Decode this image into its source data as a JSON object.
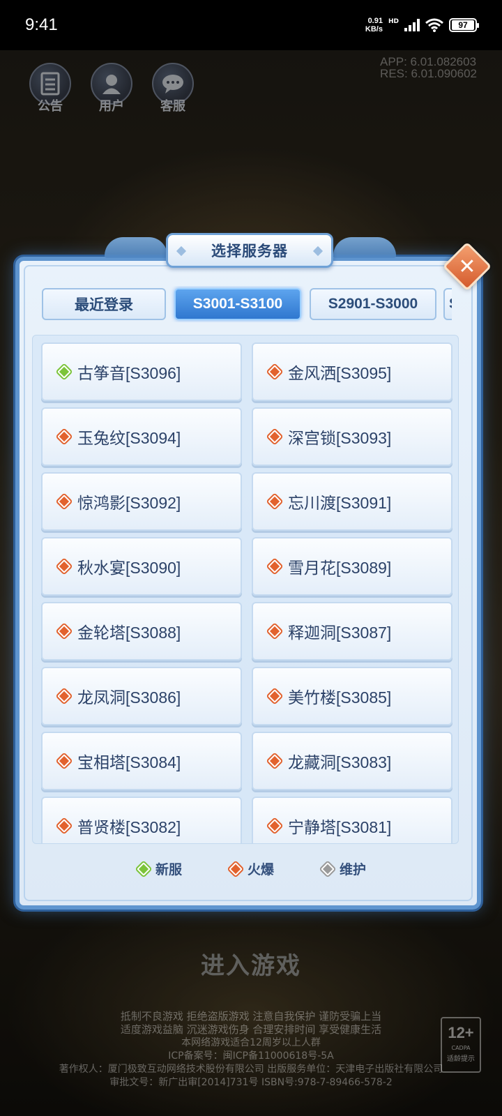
{
  "status_bar": {
    "time": "9:41",
    "speed_value": "0.91",
    "speed_unit": "KB/s",
    "net_type": "HD",
    "battery": "97"
  },
  "top_icons": [
    {
      "label": "公告",
      "icon": "notice-icon"
    },
    {
      "label": "用户",
      "icon": "user-icon"
    },
    {
      "label": "客服",
      "icon": "support-icon"
    }
  ],
  "version": {
    "app": "APP: 6.01.082603",
    "res": "RES: 6.01.090602"
  },
  "dialog": {
    "title": "选择服务器",
    "close_icon": "close-icon"
  },
  "tabs": [
    {
      "label": "最近登录",
      "active": false
    },
    {
      "label": "S3001-S3100",
      "active": true
    },
    {
      "label": "S2901-S3000",
      "active": false
    },
    {
      "label": "S",
      "active": false
    }
  ],
  "servers": [
    {
      "name": "古筝音[S3096]",
      "status": "new"
    },
    {
      "name": "金风洒[S3095]",
      "status": "hot"
    },
    {
      "name": "玉兔纹[S3094]",
      "status": "hot"
    },
    {
      "name": "深宫锁[S3093]",
      "status": "hot"
    },
    {
      "name": "惊鸿影[S3092]",
      "status": "hot"
    },
    {
      "name": "忘川渡[S3091]",
      "status": "hot"
    },
    {
      "name": "秋水宴[S3090]",
      "status": "hot"
    },
    {
      "name": "雪月花[S3089]",
      "status": "hot"
    },
    {
      "name": "金轮塔[S3088]",
      "status": "hot"
    },
    {
      "name": "释迦洞[S3087]",
      "status": "hot"
    },
    {
      "name": "龙凤洞[S3086]",
      "status": "hot"
    },
    {
      "name": "美竹楼[S3085]",
      "status": "hot"
    },
    {
      "name": "宝相塔[S3084]",
      "status": "hot"
    },
    {
      "name": "龙藏洞[S3083]",
      "status": "hot"
    },
    {
      "name": "普贤楼[S3082]",
      "status": "hot"
    },
    {
      "name": "宁静塔[S3081]",
      "status": "hot"
    }
  ],
  "legend": [
    {
      "label": "新服",
      "color": "#7cc43a"
    },
    {
      "label": "火爆",
      "color": "#e2622e"
    },
    {
      "label": "维护",
      "color": "#9a9a9a"
    }
  ],
  "status_colors": {
    "new": "#7cc43a",
    "hot": "#e2622e",
    "maintenance": "#9a9a9a"
  },
  "enter_game": "进入游戏",
  "notice": {
    "line1": "抵制不良游戏 拒绝盗版游戏 注意自我保护 谨防受骗上当",
    "line2": "适度游戏益脑 沉迷游戏伤身 合理安排时间 享受健康生活",
    "line3": "本网络游戏适合12周岁以上人群",
    "line4": "ICP备案号：闽ICP备11000618号-5A",
    "line5": "著作权人：厦门极致互动网络技术股份有限公司 出版服务单位：天津电子出版社有限公司",
    "line6": "审批文号：新广出审[2014]731号 ISBN号:978-7-89466-578-2"
  },
  "age_badge": {
    "rating": "12+",
    "org": "CADPA",
    "label": "适龄提示"
  }
}
